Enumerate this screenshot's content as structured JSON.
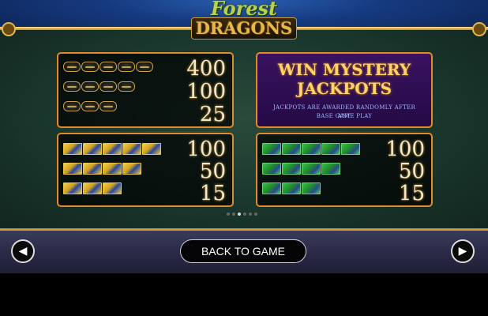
{
  "logo": {
    "line1": "Forest",
    "line2": "DRAGONS"
  },
  "panels": [
    {
      "symbol": "dragon-logo",
      "pays": [
        "400",
        "100",
        "25"
      ],
      "counts": [
        5,
        4,
        3
      ]
    },
    {
      "symbol": "gold-scale",
      "pays": [
        "100",
        "50",
        "15"
      ],
      "counts": [
        5,
        4,
        3
      ]
    },
    {
      "symbol": "green-scale",
      "pays": [
        "100",
        "50",
        "15"
      ],
      "counts": [
        5,
        4,
        3
      ]
    }
  ],
  "mystery": {
    "title_line1": "WIN MYSTERY",
    "title_line2": "JACKPOTS",
    "subtitle_line1": "Jackpots are awarded randomly after any",
    "subtitle_line2": "base game play"
  },
  "pager": {
    "total": 6,
    "active_index": 2
  },
  "buttons": {
    "back_label": "BACK TO GAME",
    "prev_icon": "arrow-left-icon",
    "next_icon": "arrow-right-icon"
  },
  "colors": {
    "panel_border": "#e08a2a",
    "gold_trim": "#c99a3a",
    "mystery_bg": "#2e0e52",
    "pay_text": "#f0e8d0"
  }
}
